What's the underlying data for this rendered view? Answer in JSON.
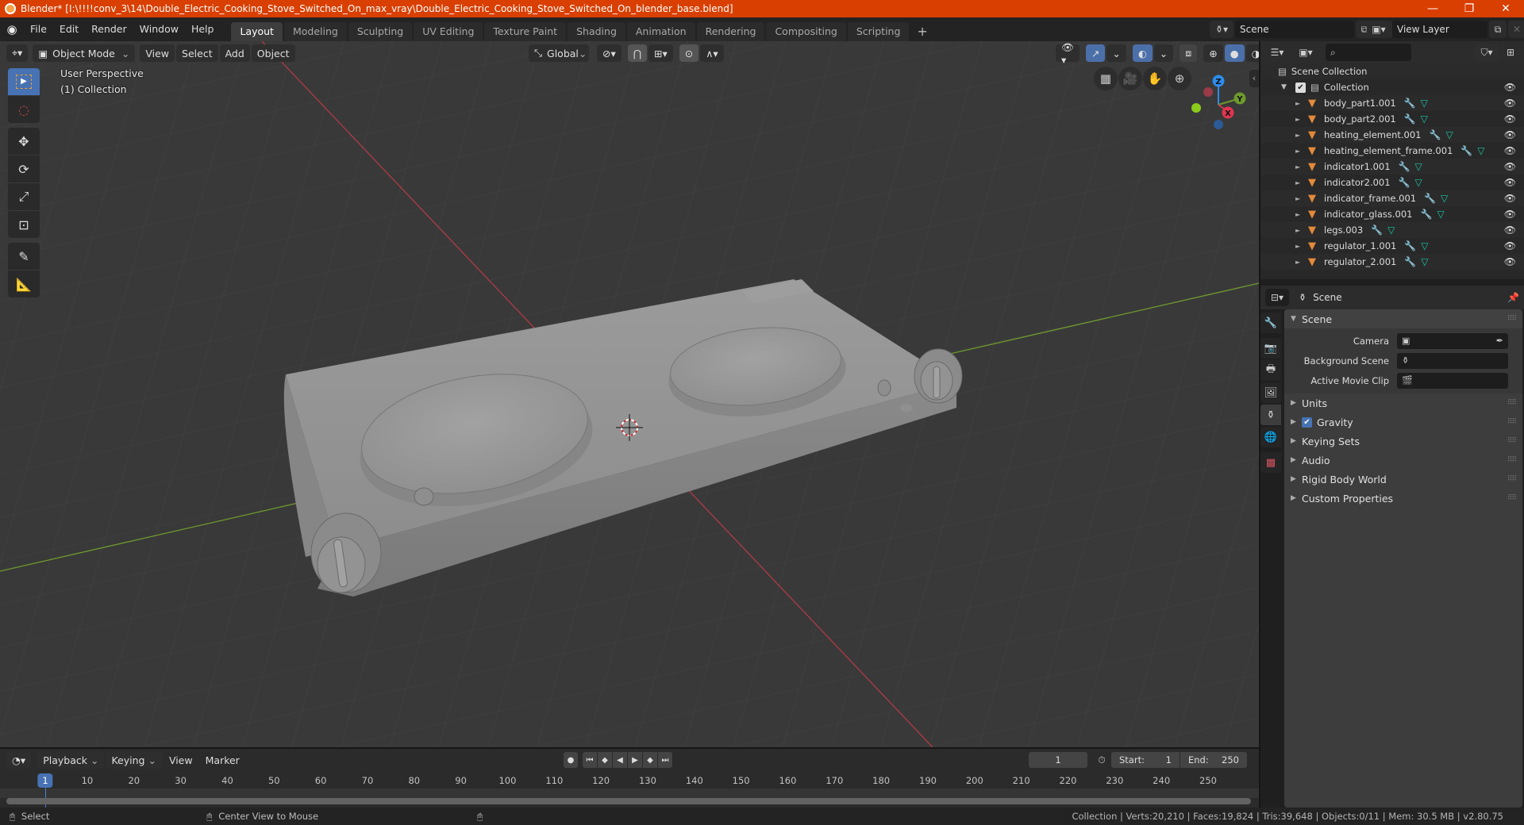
{
  "window": {
    "title": "Blender* [I:\\!!!!conv_3\\14\\Double_Electric_Cooking_Stove_Switched_On_max_vray\\Double_Electric_Cooking_Stove_Switched_On_blender_base.blend]",
    "minimize": "—",
    "maximize": "❐",
    "close": "✕"
  },
  "menubar": {
    "items": [
      "File",
      "Edit",
      "Render",
      "Window",
      "Help"
    ],
    "workspaces": [
      "Layout",
      "Modeling",
      "Sculpting",
      "UV Editing",
      "Texture Paint",
      "Shading",
      "Animation",
      "Rendering",
      "Compositing",
      "Scripting"
    ],
    "active_workspace": "Layout",
    "add_workspace": "+",
    "scene": "Scene",
    "view_layer": "View Layer"
  },
  "viewport": {
    "mode": "Object Mode",
    "menus": [
      "View",
      "Select",
      "Add",
      "Object"
    ],
    "orientation": "Global",
    "perspective_label": "User Perspective",
    "collection_label": "(1) Collection",
    "gizmo_axes": {
      "x": "X",
      "y": "Y",
      "z": "Z"
    },
    "colors": {
      "x_axis": "#c9384c",
      "y_axis": "#6f9a2c",
      "z_axis": "#2d8ceb",
      "background": "#393939",
      "grid": "#454545"
    }
  },
  "outliner": {
    "root": "Scene Collection",
    "collection": "Collection",
    "objects": [
      "body_part1.001",
      "body_part2.001",
      "heating_element.001",
      "heating_element_frame.001",
      "indicator1.001",
      "indicator2.001",
      "indicator_frame.001",
      "indicator_glass.001",
      "legs.003",
      "regulator_1.001",
      "regulator_2.001"
    ]
  },
  "properties": {
    "context": "Scene",
    "panel_title": "Scene",
    "fields": [
      {
        "label": "Camera",
        "value": ""
      },
      {
        "label": "Background Scene",
        "value": ""
      },
      {
        "label": "Active Movie Clip",
        "value": ""
      }
    ],
    "subpanels": [
      {
        "label": "Units",
        "checkbox": false
      },
      {
        "label": "Gravity",
        "checkbox": true,
        "checked": true
      },
      {
        "label": "Keying Sets",
        "checkbox": false
      },
      {
        "label": "Audio",
        "checkbox": false
      },
      {
        "label": "Rigid Body World",
        "checkbox": false
      },
      {
        "label": "Custom Properties",
        "checkbox": false
      }
    ]
  },
  "timeline": {
    "menus": [
      "Playback",
      "Keying",
      "View",
      "Marker"
    ],
    "current_frame": "1",
    "start_label": "Start:",
    "start": "1",
    "end_label": "End:",
    "end": "250",
    "ticks": [
      "1",
      "10",
      "20",
      "30",
      "40",
      "50",
      "60",
      "70",
      "80",
      "90",
      "100",
      "110",
      "120",
      "130",
      "140",
      "150",
      "160",
      "170",
      "180",
      "190",
      "200",
      "210",
      "220",
      "230",
      "240",
      "250"
    ]
  },
  "statusbar": {
    "left_hint": "Select",
    "middle_hint": "Center View to Mouse",
    "stats": "Collection | Verts:20,210 | Faces:19,824 | Tris:39,648 | Objects:0/11 | Mem: 30.5 MB | v2.80.75"
  }
}
